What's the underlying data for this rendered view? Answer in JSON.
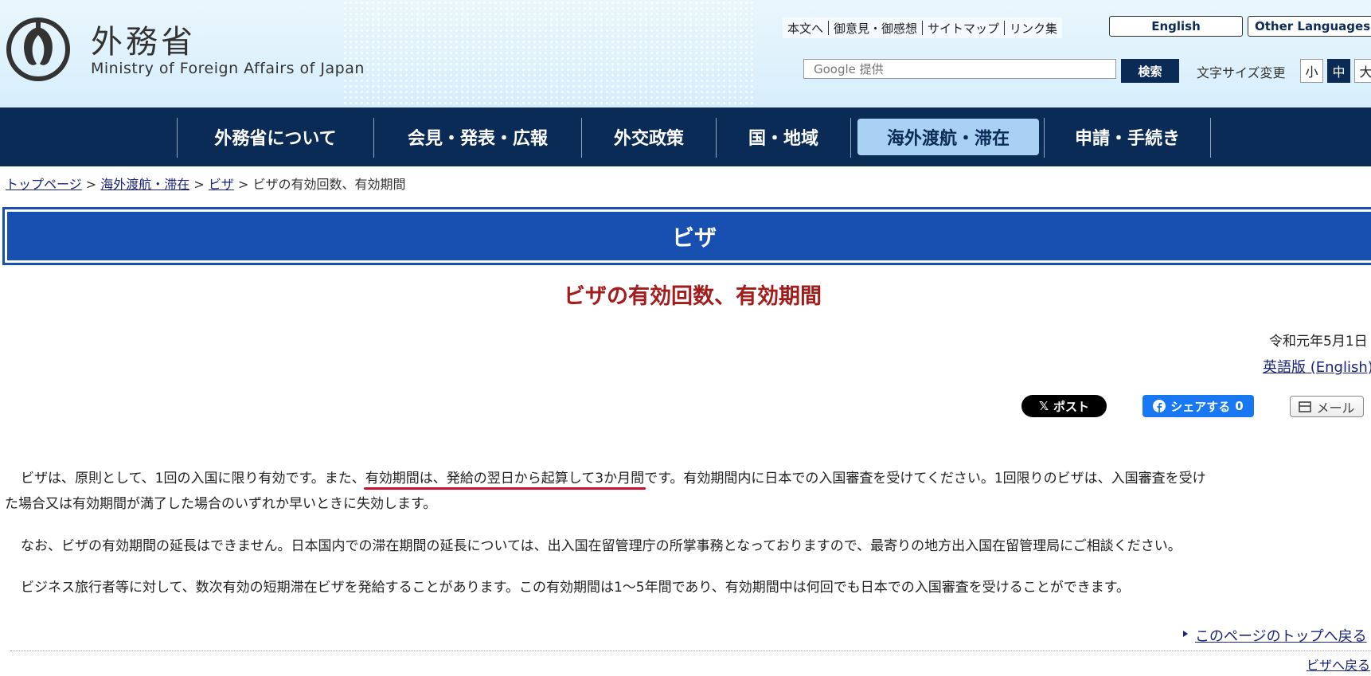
{
  "header": {
    "logo_jp": "外務省",
    "logo_en": "Ministry of Foreign Affairs of Japan",
    "util_links": [
      "本文へ",
      "御意見・御感想",
      "サイトマップ",
      "リンク集"
    ],
    "english_label": "English",
    "other_languages_label": "Other Languages",
    "search": {
      "placeholder": "Google 提供",
      "button_label": "検索"
    },
    "font_size": {
      "label": "文字サイズ変更",
      "small": "小",
      "medium": "中",
      "large": "大",
      "selected": "中"
    }
  },
  "nav": {
    "items": [
      {
        "label": "外務省について"
      },
      {
        "label": "会見・発表・広報"
      },
      {
        "label": "外交政策"
      },
      {
        "label": "国・地域"
      },
      {
        "label": "海外渡航・滞在",
        "active": true
      },
      {
        "label": "申請・手続き"
      }
    ]
  },
  "breadcrumb": {
    "items": [
      "トップページ",
      "海外渡航・滞在",
      "ビザ"
    ],
    "current": "ビザの有効回数、有効期間",
    "separator": ">"
  },
  "banner": {
    "title": "ビザ"
  },
  "page": {
    "title": "ビザの有効回数、有効期間",
    "date": "令和元年5月1日",
    "english_link": "英語版 (English)"
  },
  "share": {
    "x_label": "ポスト",
    "fb_label": "シェアする",
    "fb_count": "0",
    "mail_label": "メール"
  },
  "body": {
    "p1_before": "ビザは、原則として、1回の入国に限り有効です。また、",
    "p1_highlight": "有効期間は、発給の翌日から起算して3か月間",
    "p1_after": "です。有効期間内に日本での入国審査を受けてください。1回限りのビザは、入国審査を受け",
    "p1_line2": "た場合又は有効期間が満了した場合のいずれか早いときに失効します。",
    "p2": "なお、ビザの有効期間の延長はできません。日本国内での滞在期間の延長については、出入国在留管理庁の所掌事務となっておりますので、最寄りの地方出入国在留管理局にご相談ください。",
    "p3": "ビジネス旅行者等に対して、数次有効の短期滞在ビザを発給することがあります。この有効期間は1～5年間であり、有効期間中は何回でも日本での入国審査を受けることができます。"
  },
  "footer": {
    "back_to_top": "このページのトップへ戻る",
    "back_to_visa": "ビザへ戻る"
  },
  "colors": {
    "nav_bg": "#0b2b57",
    "nav_active_bg": "#a9d1f3",
    "banner_bg": "#1750b0",
    "title_red": "#a31c1c",
    "link": "#1a237e",
    "highlight_underline": "#c8102e"
  }
}
